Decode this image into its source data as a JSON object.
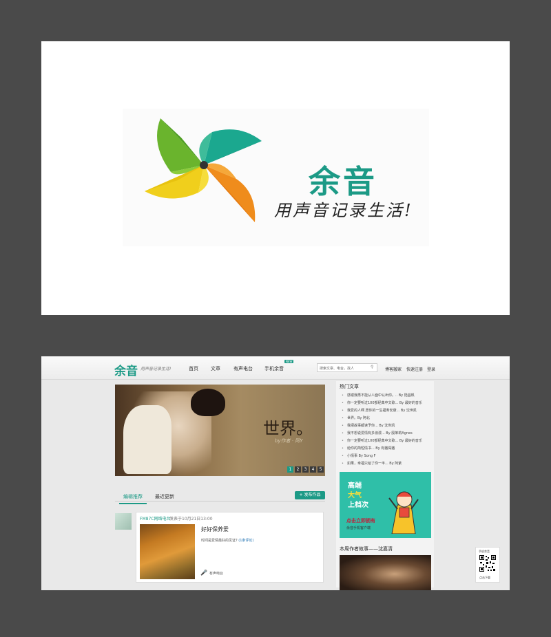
{
  "logo_card": {
    "brand_name": "余音",
    "slogan": "用声音记录生活!"
  },
  "site": {
    "logo": "余音",
    "slogan": "用声音记录生活!",
    "nav": [
      "首页",
      "文章",
      "有声电台",
      "手机余音"
    ],
    "nav_badge": "NEW",
    "search_placeholder": "搜索文章、电台，找人",
    "top_links": [
      "博客搬家",
      "快速注册",
      "登录"
    ],
    "banner": {
      "title": "世界。",
      "subtitle": "by作者 · 阿Y",
      "pages": [
        "1",
        "2",
        "3",
        "4",
        "5"
      ]
    },
    "tabs": [
      "编辑推荐",
      "最近更新"
    ],
    "publish_button": "+ 发布作品",
    "post": {
      "source": "FM87C网络电台",
      "time": "发表于10月21日13:00",
      "title": "好好保养爱",
      "desc": "时间是爱情最好的见证?",
      "comments": "(1条评论)",
      "type": "有声电台"
    },
    "sidebar": {
      "hot_title": "热门文章",
      "hot_items": [
        "感谢我再不能从人面中认出你。.. By 陆昌帆",
        "你一定要听过100部经典中文歌... By 最好的音乐",
        "我爱的人啊 愿你的一生福寿安康... By 沈世凯",
        "世界。By 阿北",
        "我把故事都读予你... By 沈世凯",
        "我不想说爱情有多浪漫... By 殷茉莉Agnes",
        "你一定要听过100部经典中文歌... By 最好的音乐",
        "给你的简短情书... By 有猪得猪",
        "小情事 By Song F",
        "如果，幸福只给了你一半... By 阿紫"
      ],
      "ad": {
        "line1": "高端",
        "line2": "大气",
        "line3": "上档次",
        "line4": "点击立即拥有",
        "line5": "余音手机客户端"
      },
      "author_title": "本周作者故事——沈嘉清"
    },
    "qr": {
      "title": "手机余音",
      "bottom": "点击下载"
    }
  },
  "colors": {
    "brand": "#1c9a86",
    "background": "#4a4a4a"
  }
}
